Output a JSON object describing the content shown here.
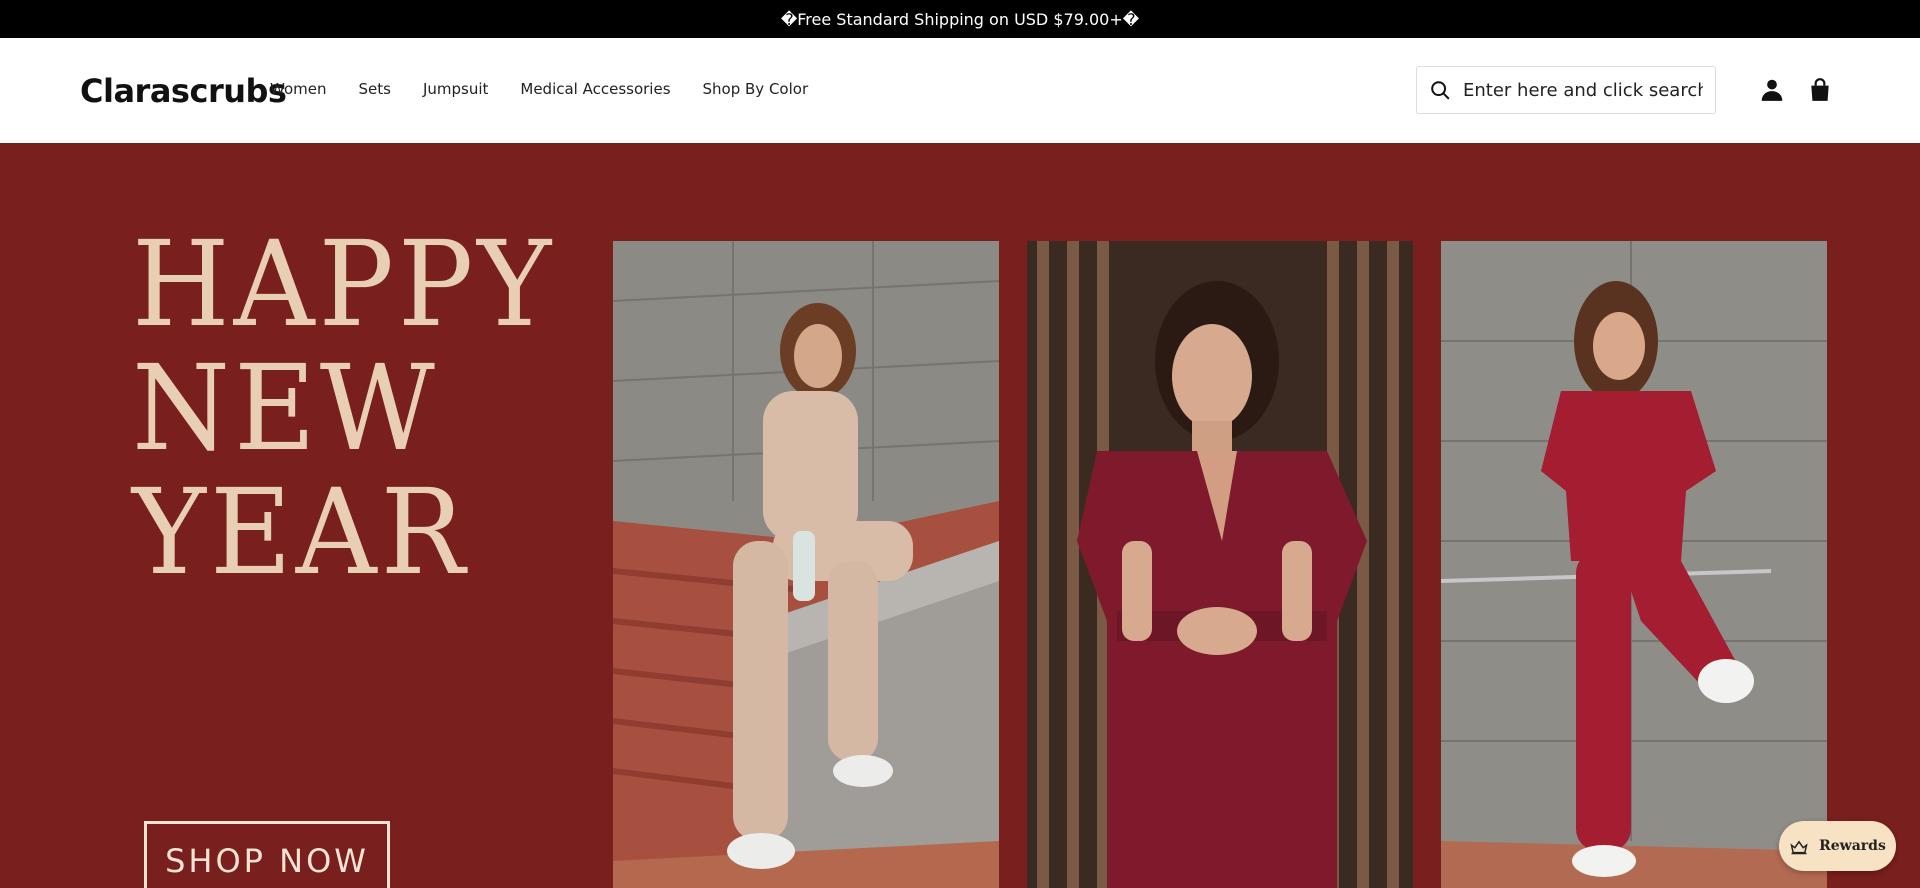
{
  "announcement": {
    "text": "�Free Standard Shipping on USD $79.00+�"
  },
  "header": {
    "logo": "Clarascrubs",
    "nav": [
      "Women",
      "Sets",
      "Jumpsuit",
      "Medical Accessories",
      "Shop By Color"
    ],
    "search": {
      "placeholder": "Enter here and click search",
      "icon": "search-icon"
    },
    "icons": [
      "account-icon",
      "cart-bag-icon"
    ]
  },
  "hero": {
    "headline": [
      "HAPPY",
      "NEW",
      "YEAR"
    ],
    "cta": "SHOP NOW",
    "photos": [
      {
        "description": "woman in beige scrubs sitting on concrete ledge"
      },
      {
        "description": "woman in burgundy jumpsuit"
      },
      {
        "description": "woman in red scrubs leaning on wall"
      }
    ],
    "colors": {
      "background": "#791f1d",
      "headline": "#e8cfb3"
    }
  },
  "rewards": {
    "label": "Rewards",
    "icon": "crown-gift-icon"
  }
}
